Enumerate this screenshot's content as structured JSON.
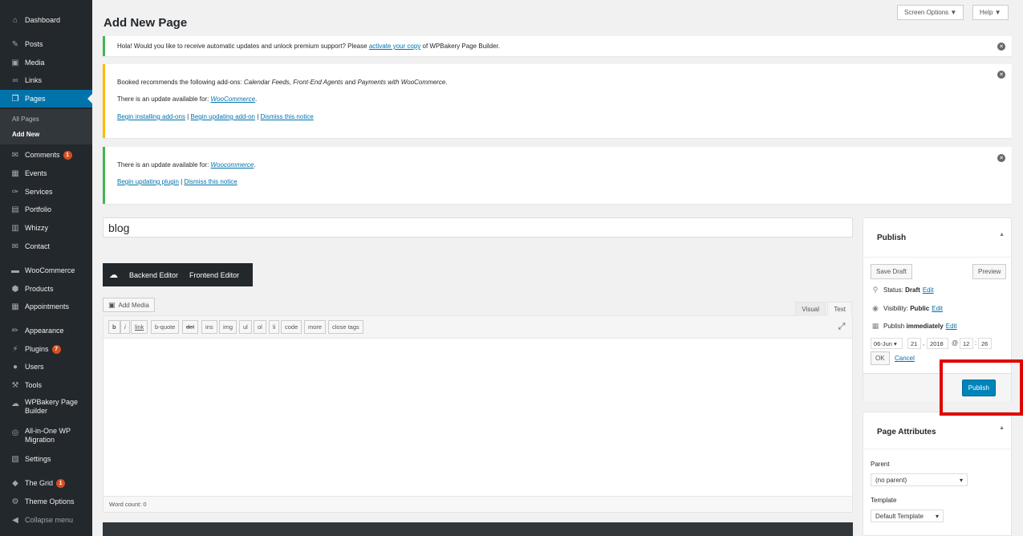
{
  "sidebar": {
    "items": [
      {
        "id": "dashboard",
        "label": "Dashboard",
        "icon": "⌂"
      },
      {
        "id": "posts",
        "label": "Posts",
        "icon": "✎"
      },
      {
        "id": "media",
        "label": "Media",
        "icon": "▣"
      },
      {
        "id": "links",
        "label": "Links",
        "icon": "∞"
      },
      {
        "id": "pages",
        "label": "Pages",
        "icon": "❐"
      },
      {
        "id": "comments",
        "label": "Comments",
        "icon": "✉",
        "badge": "1"
      },
      {
        "id": "events",
        "label": "Events",
        "icon": "▦"
      },
      {
        "id": "services",
        "label": "Services",
        "icon": "✑"
      },
      {
        "id": "portfolio",
        "label": "Portfolio",
        "icon": "▤"
      },
      {
        "id": "whizzy",
        "label": "Whizzy",
        "icon": "▥"
      },
      {
        "id": "contact",
        "label": "Contact",
        "icon": "✉"
      },
      {
        "id": "woocommerce",
        "label": "WooCommerce",
        "icon": "▬"
      },
      {
        "id": "products",
        "label": "Products",
        "icon": "⬢"
      },
      {
        "id": "appointments",
        "label": "Appointments",
        "icon": "▦"
      },
      {
        "id": "appearance",
        "label": "Appearance",
        "icon": "✏"
      },
      {
        "id": "plugins",
        "label": "Plugins",
        "icon": "⚡",
        "badge": "7"
      },
      {
        "id": "users",
        "label": "Users",
        "icon": "●"
      },
      {
        "id": "tools",
        "label": "Tools",
        "icon": "⚒"
      },
      {
        "id": "wpbakery",
        "label": "WPBakery Page Builder",
        "icon": "☁"
      },
      {
        "id": "aio",
        "label": "All-in-One WP Migration",
        "icon": "◎"
      },
      {
        "id": "settings",
        "label": "Settings",
        "icon": "▧"
      },
      {
        "id": "thegrid",
        "label": "The Grid",
        "icon": "◆",
        "badge": "1"
      },
      {
        "id": "theme",
        "label": "Theme Options",
        "icon": "⚙"
      },
      {
        "id": "collapse",
        "label": "Collapse menu",
        "icon": "◀"
      }
    ],
    "submenu": {
      "all_pages": "All Pages",
      "add_new": "Add New"
    }
  },
  "header": {
    "title": "Add New Page",
    "screen_options": "Screen Options ▼",
    "help": "Help ▼"
  },
  "notices": {
    "n1": {
      "text1": "Hola! Would you like to receive automatic updates and unlock premium support? Please ",
      "link": "activate your copy",
      "text2": " of WPBakery Page Builder."
    },
    "n2": {
      "l1a": "Booked recommends the following add-ons: ",
      "l1b": "Calendar Feeds, Front-End Agents",
      "l1c": " and ",
      "l1d": "Payments with WooCommerce",
      "l1e": ".",
      "l2a": "There is an update available for: ",
      "l2b": "WooCommerce",
      "l2c": ".",
      "l3a": "Begin installing add-ons",
      "l3sep1": " | ",
      "l3b": "Begin updating add-on",
      "l3sep2": " | ",
      "l3c": "Dismiss this notice"
    },
    "n3": {
      "l1a": "There is an update available for: ",
      "l1b": "Woocommerce",
      "l1c": ".",
      "l2a": "Begin updating plugin",
      "l2sep": " | ",
      "l2b": "Dismiss this notice"
    },
    "dismiss": "✕"
  },
  "editor": {
    "title_value": "blog",
    "vc_backend": "Backend Editor",
    "vc_frontend": "Frontend Editor",
    "add_media": "Add Media",
    "tab_visual": "Visual",
    "tab_text": "Text",
    "quicktags": [
      "b",
      "i",
      "link",
      "b-quote",
      "del",
      "ins",
      "img",
      "ul",
      "ol",
      "li",
      "code",
      "more",
      "close tags"
    ],
    "word_count": "Word count: 0"
  },
  "publish": {
    "title": "Publish",
    "save_draft": "Save Draft",
    "preview": "Preview",
    "status_label": "Status:",
    "status_value": "Draft",
    "status_edit": "Edit",
    "visibility_label": "Visibility:",
    "visibility_value": "Public",
    "visibility_edit": "Edit",
    "publish_label": "Publish",
    "publish_value": "immediately",
    "publish_edit": "Edit",
    "month": "06-Jun",
    "day": "21",
    "year": "2018",
    "hour": "12",
    "minute": "26",
    "at": "@",
    "comma": ",",
    "colon": ":",
    "ok": "OK",
    "cancel": "Cancel",
    "publish_button": "Publish"
  },
  "attributes": {
    "title": "Page Attributes",
    "parent_label": "Parent",
    "parent_value": "(no parent)",
    "template_label": "Template",
    "template_value": "Default Template"
  },
  "colors": {
    "accent": "#0073aa",
    "publish": "#0085ba",
    "highlight": "#e00000",
    "sidebar": "#23282d"
  }
}
